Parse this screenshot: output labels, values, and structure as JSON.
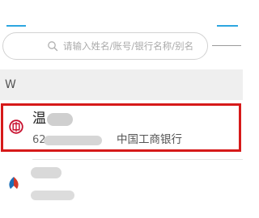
{
  "search": {
    "placeholder": "请输入姓名/账号/银行名称/别名"
  },
  "section": {
    "letter": "W"
  },
  "contact": {
    "name": "温",
    "account_prefix": "62",
    "bank": "中国工商银行"
  },
  "colors": {
    "accent": "#2da6e0",
    "highlight": "#d61a1a",
    "bank_logo": "#c8102e"
  },
  "icons": {
    "search": "search-icon",
    "bank_logo": "icbc-logo-icon",
    "next_logo": "bank-logo-icon",
    "more": "more-icon"
  }
}
